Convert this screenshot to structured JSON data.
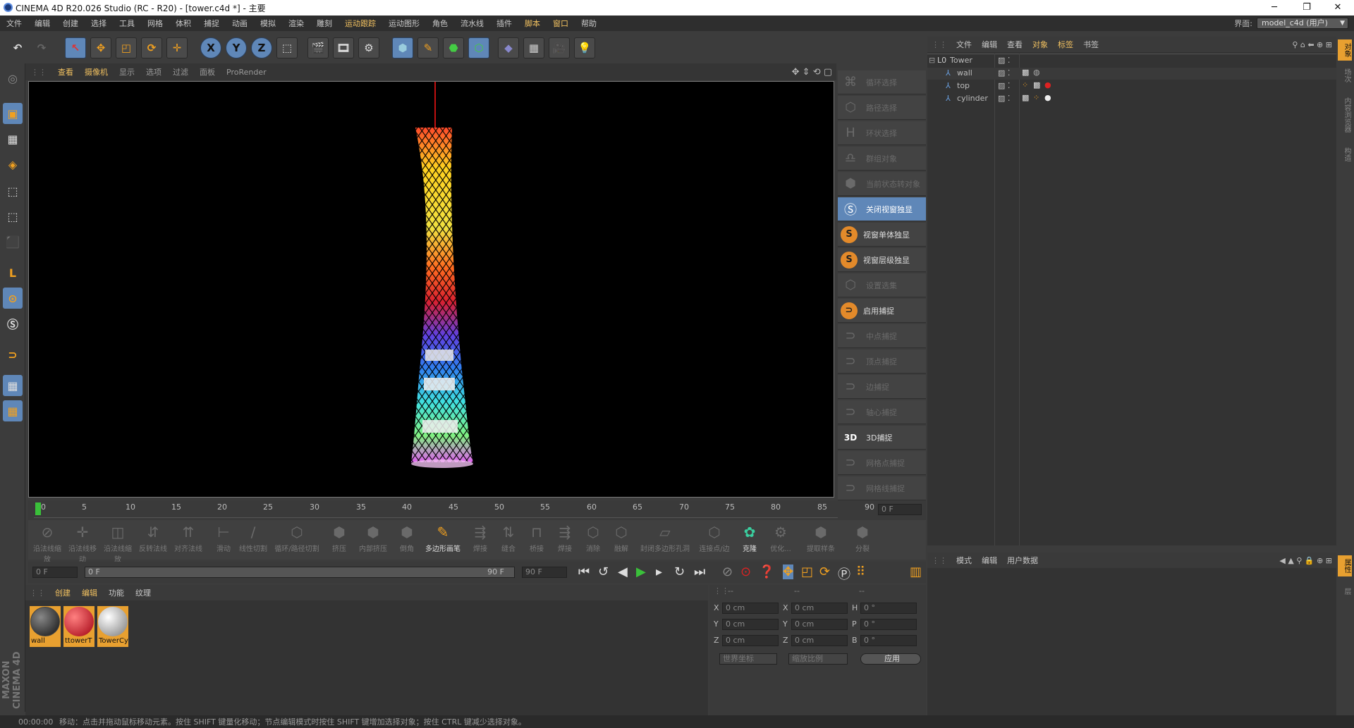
{
  "window": {
    "title": "CINEMA 4D R20.026 Studio (RC - R20) - [tower.c4d *] - 主要",
    "minimize": "─",
    "maximize": "❐",
    "close": "✕"
  },
  "menubar": {
    "items": [
      "文件",
      "编辑",
      "创建",
      "选择",
      "工具",
      "网格",
      "体积",
      "捕捉",
      "动画",
      "模拟",
      "渲染",
      "雕刻",
      "运动跟踪",
      "运动图形",
      "角色",
      "流水线",
      "插件",
      "脚本",
      "窗口",
      "帮助"
    ],
    "layout_label": "界面:",
    "layout_value": "model_c4d (用户)"
  },
  "viewport": {
    "menu": [
      "查看",
      "摄像机",
      "显示",
      "选项",
      "过滤",
      "面板",
      "ProRender"
    ]
  },
  "palette": {
    "items": [
      {
        "label": "循环选择",
        "state": "off"
      },
      {
        "label": "路径选择",
        "state": "off"
      },
      {
        "label": "环状选择",
        "state": "off"
      },
      {
        "label": "群组对象",
        "state": "off"
      },
      {
        "label": "当前状态转对象",
        "state": "off"
      },
      {
        "label": "关闭视窗独显",
        "state": "sel"
      },
      {
        "label": "视窗单体独显",
        "state": "on"
      },
      {
        "label": "视窗层级独显",
        "state": "on"
      },
      {
        "label": "设置选集",
        "state": "off"
      },
      {
        "label": "启用捕捉",
        "state": "on"
      },
      {
        "label": "中点捕捉",
        "state": "off"
      },
      {
        "label": "顶点捕捉",
        "state": "off"
      },
      {
        "label": "边捕捉",
        "state": "off"
      },
      {
        "label": "轴心捕捉",
        "state": "off"
      },
      {
        "label": "3D捕捉",
        "state": "on"
      },
      {
        "label": "网格点捕捉",
        "state": "off"
      },
      {
        "label": "网格线捕捉",
        "state": "off"
      }
    ]
  },
  "timeline": {
    "ticks": [
      "0",
      "5",
      "10",
      "15",
      "20",
      "25",
      "30",
      "35",
      "40",
      "45",
      "50",
      "55",
      "60",
      "65",
      "70",
      "75",
      "80",
      "85",
      "90"
    ],
    "current_frame": "0 F"
  },
  "modeling": {
    "tools": [
      "沿法线缩放",
      "沿法线移动",
      "沿法线缩放",
      "反转法线",
      "对齐法线",
      "滑动",
      "线性切割",
      "循环/路径切割",
      "挤压",
      "内部挤压",
      "倒角",
      "多边形画笔",
      "焊接",
      "缝合",
      "桥接",
      "焊接",
      "消除",
      "融解",
      "封闭多边形孔洞",
      "连接点/边",
      "克隆",
      "优化...",
      "提取样条",
      "分裂"
    ],
    "active": [
      "多边形画笔",
      "克隆"
    ]
  },
  "transport": {
    "start": "0 F",
    "range_start": "0 F",
    "range_end": "90 F",
    "end": "90 F"
  },
  "materials": {
    "menu": [
      "创建",
      "编辑",
      "功能",
      "纹理"
    ],
    "items": [
      "wall",
      "ttowerT",
      "TowerCy"
    ],
    "colors": [
      "#2a2a2a",
      "#c8121a",
      "#d8d8d8"
    ]
  },
  "coords": {
    "headers": [
      "--",
      "--",
      "--"
    ],
    "rows": [
      {
        "a": "X",
        "v1": "0 cm",
        "b": "X",
        "v2": "0 cm",
        "c": "H",
        "v3": "0 °"
      },
      {
        "a": "Y",
        "v1": "0 cm",
        "b": "Y",
        "v2": "0 cm",
        "c": "P",
        "v3": "0 °"
      },
      {
        "a": "Z",
        "v1": "0 cm",
        "b": "Z",
        "v2": "0 cm",
        "c": "B",
        "v3": "0 °"
      }
    ],
    "world": "世界坐标",
    "scale": "缩放比例",
    "apply": "应用"
  },
  "objects": {
    "menu": [
      "文件",
      "编辑",
      "查看",
      "对象",
      "标签",
      "书签"
    ],
    "tree": [
      {
        "name": "Tower",
        "level": 0
      },
      {
        "name": "wall",
        "level": 1
      },
      {
        "name": "top",
        "level": 1
      },
      {
        "name": "cylinder",
        "level": 1
      }
    ]
  },
  "attributes": {
    "menu": [
      "模式",
      "编辑",
      "用户数据"
    ]
  },
  "righttabs": [
    "对象",
    "场次",
    "内容浏览器",
    "构造",
    "属性",
    "层"
  ],
  "status": {
    "time": "00:00:00",
    "message": "移动：点击并拖动鼠标移动元素。按住 SHIFT 键量化移动；节点编辑模式时按住 SHIFT 键增加选择对象；按住 CTRL 键减少选择对象。"
  },
  "brand": "MAXON CINEMA 4D"
}
